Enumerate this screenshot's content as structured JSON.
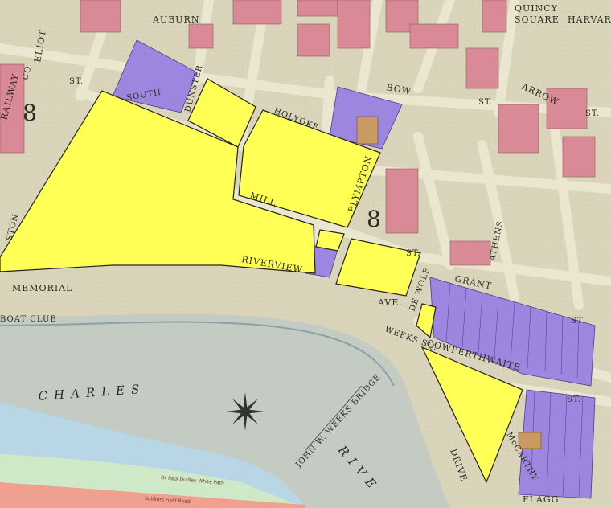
{
  "map": {
    "colors": {
      "yellow_parcel": "#ffff55",
      "purple_parcel": "#9d86e0",
      "pink_building": "#d98a96",
      "tan_building": "#c99a62",
      "river": "#c3cbc3",
      "street": "#e8e3cc",
      "modern_water": "#b8d6e6",
      "modern_road": "#f0a08e"
    },
    "street_labels": {
      "auburn": "AUBURN",
      "eliot": "ELIOT",
      "st_left": "ST.",
      "quincy": "QUINCY",
      "square": "SQUARE",
      "harvard": "HARVAR",
      "bow": "BOW",
      "st_bow": "ST.",
      "arrow": "ARROW",
      "st_arrow": "ST.",
      "south": "SOUTH",
      "dunster": "DUNSTER",
      "holyoke": "HOLYOKE",
      "mill": "MILL",
      "plympton": "PLYMPTON",
      "st_mill": "ST.",
      "riverview": "RIVERVIEW",
      "memorial": "MEMORIAL",
      "ave": "AVE.",
      "dewolf": "DE WOLF",
      "grant": "GRANT",
      "st_grant": "ST.",
      "athens": "ATHENS",
      "cowperthwaite": "COWPERTHWAITE",
      "st_cowper": "ST.",
      "mc_carthy": "McCARTHY",
      "drive": "DRIVE",
      "flagg": "FLAGG",
      "weeks_sq": "WEEKS SQ.",
      "boat_club": "BOAT CLUB",
      "railway": "RAILWAY",
      "co": "CO.",
      "ston": "STON",
      "charles": "CHARLES",
      "river": "RIVE",
      "weeks_bridge": "JOHN W. WEEKS BRIDGE",
      "plate_number_left": "8",
      "plate_number_mid": "8"
    },
    "modern_labels": {
      "paul_dudley": "Dr Paul Dudley White Path",
      "soldiers_field": "Soldiers Field Road"
    }
  }
}
